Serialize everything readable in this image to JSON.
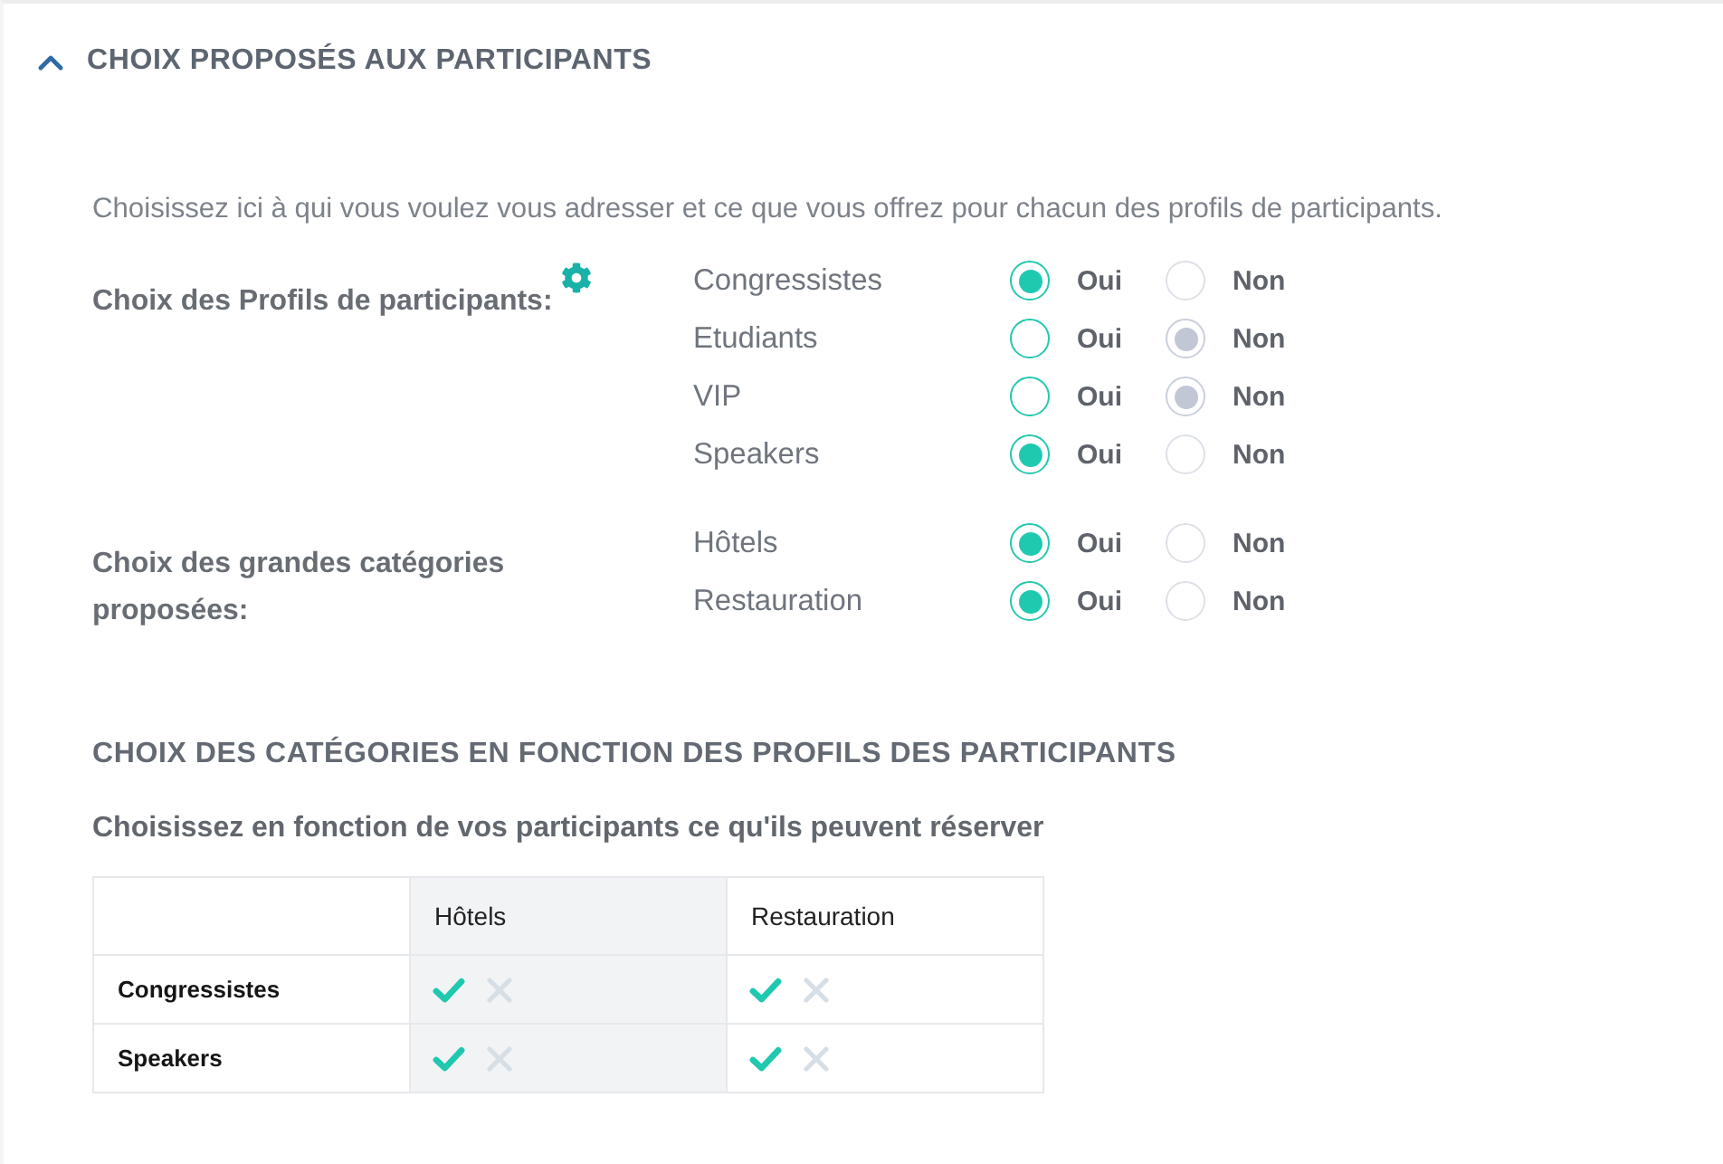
{
  "section": {
    "title": "CHOIX PROPOSÉS AUX PARTICIPANTS",
    "expanded": true
  },
  "intro": "Choisissez ici à qui vous voulez vous adresser et ce que vous offrez pour chacun des profils de participants.",
  "profiles": {
    "label": "Choix des Profils de participants:",
    "options": [
      {
        "name": "Congressistes",
        "choices": [
          {
            "label": "Oui",
            "kind": "yes",
            "selected": true
          },
          {
            "label": "Non",
            "kind": "no",
            "selected": false
          }
        ]
      },
      {
        "name": "Etudiants",
        "choices": [
          {
            "label": "Oui",
            "kind": "yes",
            "selected": false
          },
          {
            "label": "Non",
            "kind": "no",
            "selected": true
          }
        ]
      },
      {
        "name": "VIP",
        "choices": [
          {
            "label": "Oui",
            "kind": "yes",
            "selected": false
          },
          {
            "label": "Non",
            "kind": "no",
            "selected": true
          }
        ]
      },
      {
        "name": "Speakers",
        "choices": [
          {
            "label": "Oui",
            "kind": "yes",
            "selected": true
          },
          {
            "label": "Non",
            "kind": "no",
            "selected": false
          }
        ]
      }
    ]
  },
  "categories": {
    "label": "Choix des grandes catégories proposées:",
    "options": [
      {
        "name": "Hôtels",
        "choices": [
          {
            "label": "Oui",
            "kind": "yes",
            "selected": true
          },
          {
            "label": "Non",
            "kind": "no",
            "selected": false
          }
        ]
      },
      {
        "name": "Restauration",
        "choices": [
          {
            "label": "Oui",
            "kind": "yes",
            "selected": true
          },
          {
            "label": "Non",
            "kind": "no",
            "selected": false
          }
        ]
      }
    ]
  },
  "matrix": {
    "title": "CHOIX DES CATÉGORIES EN FONCTION DES PROFILS DES PARTICIPANTS",
    "subtitle": "Choisissez en fonction de vos participants ce qu'ils peuvent réserver",
    "columns": [
      {
        "label": "Hôtels",
        "highlighted": true
      },
      {
        "label": "Restauration",
        "highlighted": false
      }
    ],
    "rows": [
      {
        "label": "Congressistes",
        "cells": [
          {
            "allowed": true
          },
          {
            "allowed": true
          }
        ]
      },
      {
        "label": "Speakers",
        "cells": [
          {
            "allowed": true
          },
          {
            "allowed": true
          }
        ]
      }
    ]
  }
}
